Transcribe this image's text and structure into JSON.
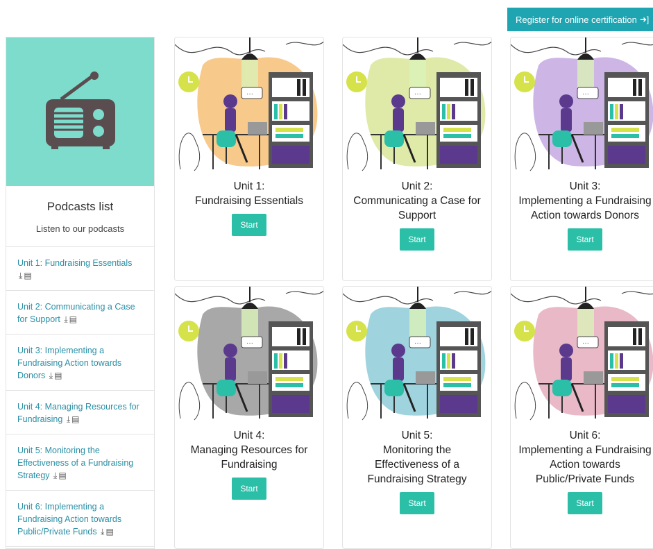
{
  "header": {
    "register_label": "Register for online certification",
    "register_icon": "sign-in-icon"
  },
  "colors": {
    "accent": "#1fa5b2",
    "start_button": "#2bbfa8",
    "sidebar_hero": "#7ddccc",
    "link": "#2a8fa5"
  },
  "sidebar": {
    "icon": "radio-icon",
    "title": "Podcasts list",
    "subtitle": "Listen to our podcasts",
    "items": [
      {
        "label": "Unit 1: Fundraising Essentials"
      },
      {
        "label": "Unit 2: Communicating a Case for Support"
      },
      {
        "label": "Unit 3: Implementing a Fundraising Action towards Donors"
      },
      {
        "label": "Unit 4: Managing Resources for Fundraising"
      },
      {
        "label": "Unit 5: Monitoring the Effectiveness of a Fundraising Strategy"
      },
      {
        "label": "Unit 6: Implementing a Fundraising Action towards Public/Private Funds"
      }
    ],
    "item_icons": [
      "download-icon",
      "document-icon"
    ]
  },
  "units": [
    {
      "unit": "Unit 1:",
      "name": "Fundraising Essentials",
      "start": "Start",
      "blob_color": "#f7c98a"
    },
    {
      "unit": "Unit 2:",
      "name": "Communicating a Case for Support",
      "start": "Start",
      "blob_color": "#dfe9a8"
    },
    {
      "unit": "Unit 3:",
      "name": "Implementing a Fundraising Action towards Donors",
      "start": "Start",
      "blob_color": "#cdb6e6"
    },
    {
      "unit": "Unit 4:",
      "name": "Managing Resources for Fundraising",
      "start": "Start",
      "blob_color": "#a8a8a8"
    },
    {
      "unit": "Unit 5:",
      "name": "Monitoring the Effectiveness of a Fundraising Strategy",
      "start": "Start",
      "blob_color": "#9fd3de"
    },
    {
      "unit": "Unit 6:",
      "name": "Implementing a Fundraising Action towards Public/Private Funds",
      "start": "Start",
      "blob_color": "#e9b9c8"
    }
  ]
}
